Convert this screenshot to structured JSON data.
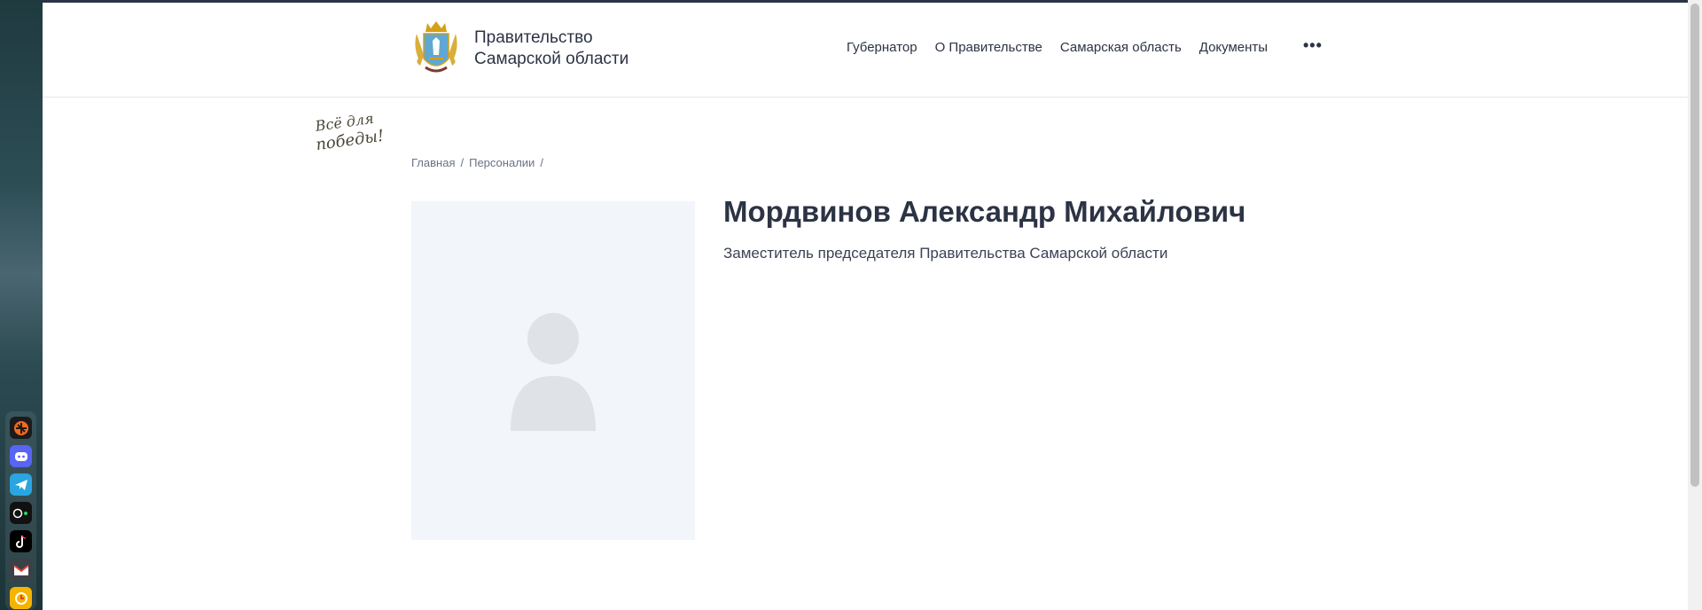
{
  "header": {
    "brand_title_line1": "Правительство",
    "brand_title_line2": "Самарской области",
    "nav": [
      "Губернатор",
      "О Правительстве",
      "Самарская область",
      "Документы"
    ],
    "more_label": "•••"
  },
  "victory_badge": "Всё для победы!",
  "breadcrumb": {
    "home": "Главная",
    "section": "Персоналии",
    "separator": "/"
  },
  "person": {
    "name": "Мордвинов Александр Михайлович",
    "position": "Заместитель председателя Правительства Самарской области"
  },
  "dock": {
    "apps": [
      "app-launcher-icon",
      "discord-icon",
      "telegram-icon",
      "media-icon",
      "tiktok-icon",
      "mail-icon",
      "timer-icon"
    ]
  },
  "colors": {
    "text_primary": "#2c3344",
    "placeholder_bg": "#f2f5f9",
    "placeholder_figure": "#dfe2e6",
    "header_border": "#e3e6ec"
  }
}
